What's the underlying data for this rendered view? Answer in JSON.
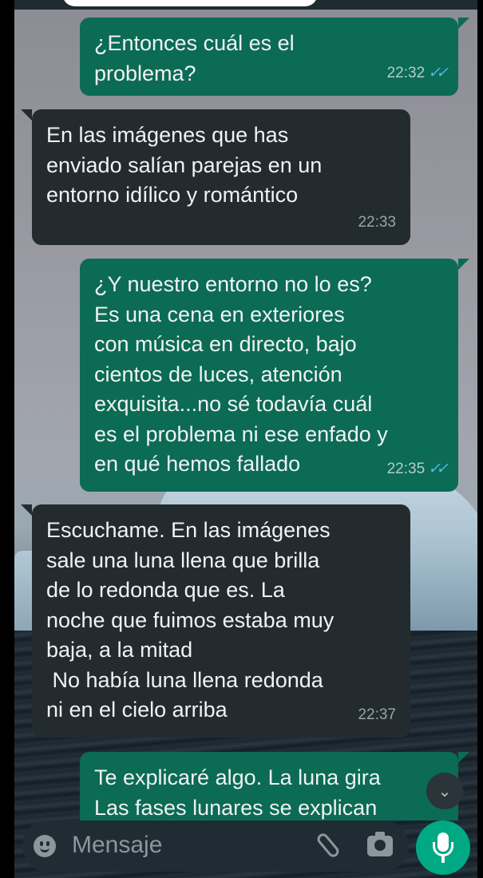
{
  "messages": [
    {
      "direction": "out",
      "text": "¿Entonces cuál es el\nproblema?",
      "time": "22:32",
      "status": "read"
    },
    {
      "direction": "in",
      "text": "En las imágenes que has\nenviado salían parejas en un\nentorno idílico y romántico",
      "time": "22:33"
    },
    {
      "direction": "out",
      "text": "¿Y nuestro entorno no lo es?\nEs una cena en exteriores\ncon música en directo, bajo\ncientos de luces, atención\nexquisita...no sé todavía cuál\nes el problema ni ese enfado y\nen qué hemos fallado",
      "time": "22:35",
      "status": "read"
    },
    {
      "direction": "in",
      "text": "Escuchame. En las imágenes\nsale una luna llena que brilla\nde lo redonda que es. La\nnoche que fuimos estaba muy\nbaja, a la mitad\n No había luna llena redonda\nni en el cielo arriba",
      "time": "22:37"
    },
    {
      "direction": "out",
      "text": "Te explicaré algo. La luna gira\nLas fases lunares se explican",
      "time": ""
    }
  ],
  "composer": {
    "placeholder": "Mensaje",
    "icons": [
      "emoji-icon",
      "attach-icon",
      "camera-icon",
      "mic-icon"
    ]
  },
  "scroll_down_icon": "chevron-double-down-icon",
  "read_tick": "✓✓",
  "scroll_glyph": "⌄",
  "colors": {
    "outgoing_bubble": "#0b6b55",
    "incoming_bubble": "#232b2f",
    "read_receipt": "#53bdeb",
    "mic_button": "#00a884"
  }
}
